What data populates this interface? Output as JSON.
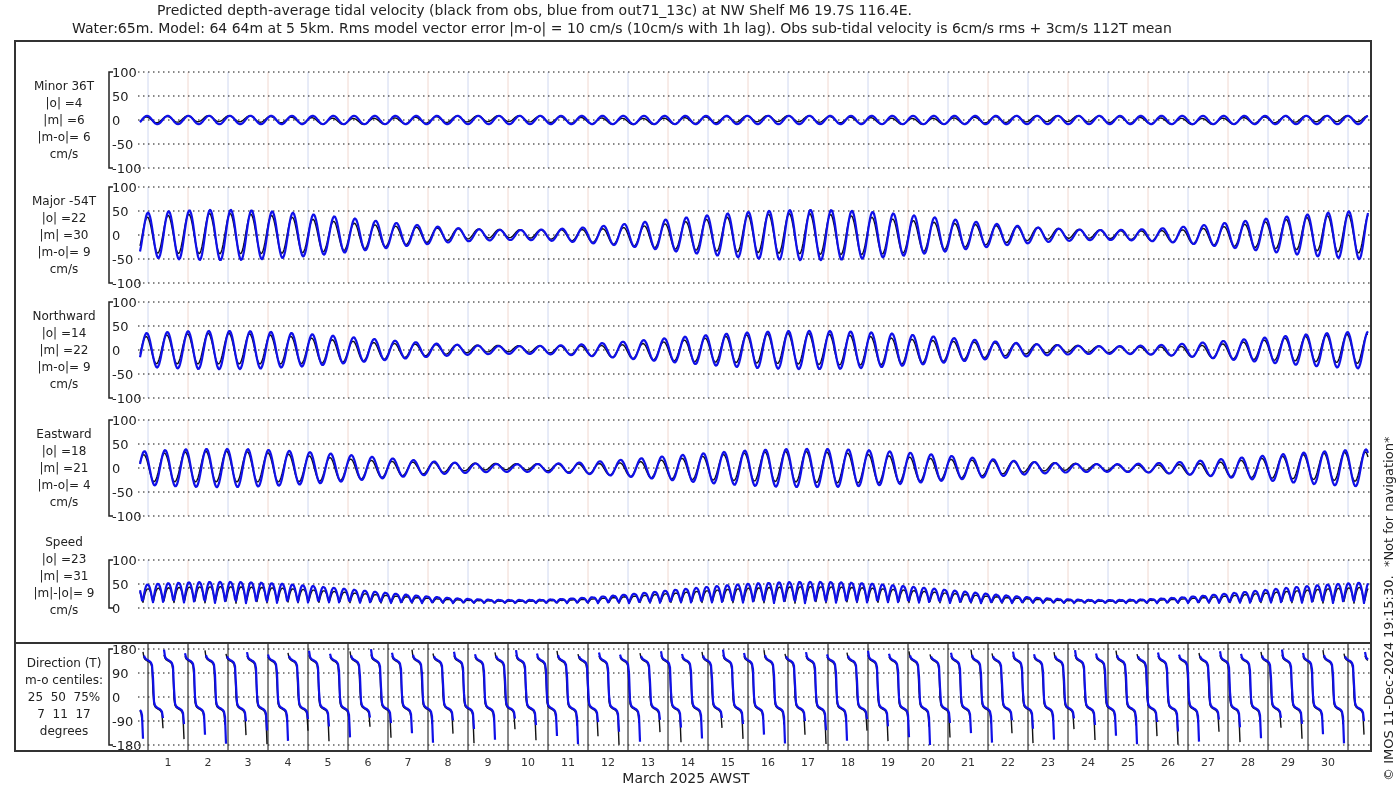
{
  "title": [
    "Predicted depth-average tidal velocity (black from obs, blue from out71_13c) at NW Shelf M6 19.7S 116.4E.",
    "Water:65m. Model: 64 64m at 5 5km. Rms model vector error |m-o| = 10 cm/s (10cm/s with 1h lag). Obs sub-tidal velocity is 6cm/s rms + 3cm/s 112T mean"
  ],
  "panels": [
    {
      "kind": "vector",
      "label_lines": [
        "Minor 36T",
        "|o| =4",
        "|m| =6",
        "|m-o|= 6",
        "cm/s"
      ],
      "yticks": [
        "100",
        "50",
        "0",
        "-50",
        "-100"
      ]
    },
    {
      "kind": "vector",
      "label_lines": [
        "Major -54T",
        "|o| =22",
        "|m| =30",
        "|m-o|= 9",
        "cm/s"
      ],
      "yticks": [
        "100",
        "50",
        "0",
        "-50",
        "-100"
      ]
    },
    {
      "kind": "vector",
      "label_lines": [
        "Northward",
        "|o| =14",
        "|m| =22",
        "|m-o|= 9",
        "cm/s"
      ],
      "yticks": [
        "100",
        "50",
        "0",
        "-50",
        "-100"
      ]
    },
    {
      "kind": "vector",
      "label_lines": [
        "Eastward",
        "|o| =18",
        "|m| =21",
        "|m-o|= 4",
        "cm/s"
      ],
      "yticks": [
        "100",
        "50",
        "0",
        "-50",
        "-100"
      ]
    },
    {
      "kind": "speed",
      "label_lines": [
        "Speed",
        "|o| =23",
        "|m| =31",
        "|m|-|o|= 9",
        "cm/s"
      ],
      "yticks": [
        "100",
        "50",
        "0"
      ]
    },
    {
      "kind": "direction",
      "label_lines": [
        "Direction (T)",
        "m-o centiles:",
        "25  50  75%",
        "7  11  17",
        "degrees"
      ],
      "yticks": [
        "180",
        "90",
        "0",
        "-90",
        "-180"
      ]
    }
  ],
  "x_axis": {
    "day_labels": [
      "1",
      "2",
      "3",
      "4",
      "5",
      "6",
      "7",
      "8",
      "9",
      "10",
      "11",
      "12",
      "13",
      "14",
      "15",
      "16",
      "17",
      "18",
      "19",
      "20",
      "21",
      "22",
      "23",
      "24",
      "25",
      "26",
      "27",
      "28",
      "29",
      "30"
    ],
    "label": "March 2025 AWST"
  },
  "credit": "© IMOS 11-Dec-2024 19:15:30.  *Not for navigation*"
}
